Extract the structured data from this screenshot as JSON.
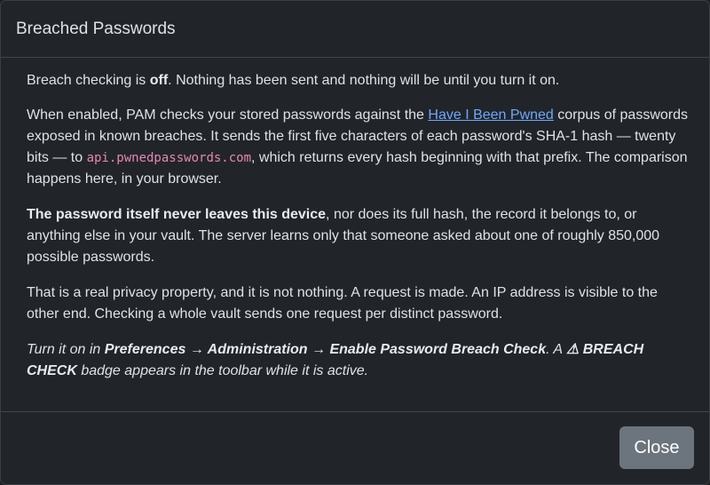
{
  "dialog": {
    "title": "Breached Passwords"
  },
  "body": {
    "p1": {
      "t1": "Breach checking is ",
      "b1": "off",
      "t2": ". Nothing has been sent and nothing will be until you turn it on."
    },
    "p2": {
      "t1": "When enabled, PAM checks your stored passwords against the ",
      "link": "Have I Been Pwned",
      "t2": " corpus of passwords exposed in known breaches. It sends the first five characters of each password's SHA-1 hash — twenty bits — to ",
      "code": "api.pwnedpasswords.com",
      "t3": ", which returns every hash beginning with that prefix. The comparison happens here, in your browser."
    },
    "p3": {
      "b1": "The password itself never leaves this device",
      "t1": ", nor does its full hash, the record it belongs to, or anything else in your vault. The server learns only that someone asked about one of roughly 850,000 possible passwords."
    },
    "p4": {
      "t1": "That is a real privacy property, and it is not nothing. A request is made. An IP address is visible to the other end. Checking a whole vault sends one request per distinct password."
    },
    "p5": {
      "t1": "Turn it on in ",
      "b1": "Preferences → Administration → Enable Password Breach Check",
      "t2": ". A ",
      "b2": "⚠ BREACH CHECK",
      "t3": " badge appears in the toolbar while it is active."
    }
  },
  "footer": {
    "close_label": "Close"
  },
  "colors": {
    "background": "#212529",
    "link": "#6ea8fe",
    "code": "#e685b5",
    "button": "#6c757d"
  }
}
